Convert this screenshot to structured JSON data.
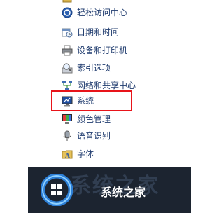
{
  "control_panel": {
    "items": [
      {
        "label": "轻松访问中心",
        "icon": "ease-of-access-icon"
      },
      {
        "label": "日期和时间",
        "icon": "calendar-clock-icon"
      },
      {
        "label": "设备和打印机",
        "icon": "printer-icon"
      },
      {
        "label": "索引选项",
        "icon": "indexing-icon"
      },
      {
        "label": "网络和共享中心",
        "icon": "network-icon"
      },
      {
        "label": "系统",
        "icon": "system-monitor-icon"
      },
      {
        "label": "颜色管理",
        "icon": "color-management-icon"
      },
      {
        "label": "语音识别",
        "icon": "microphone-icon"
      },
      {
        "label": "字体",
        "icon": "fonts-folder-icon"
      }
    ],
    "highlighted_item": "系统",
    "highlight_color": "#e8141a"
  },
  "watermark": {
    "brand_text": "系统之家",
    "background_text": "系统之家",
    "url": ""
  }
}
